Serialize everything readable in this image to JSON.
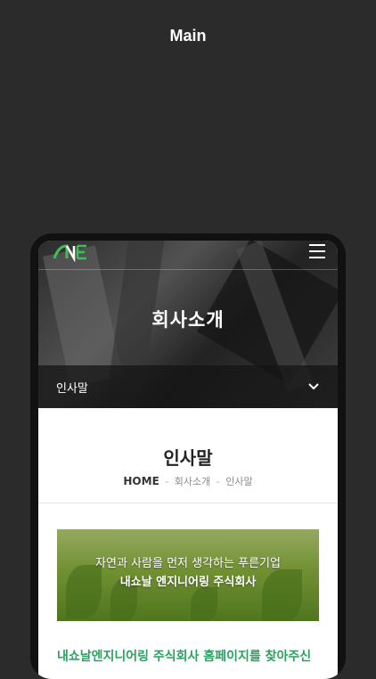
{
  "page": {
    "title": "Main"
  },
  "header": {
    "logo_text": "NE",
    "menu_icon": "hamburger-menu-icon",
    "hero_title": "회사소개"
  },
  "subnav": {
    "label": "인사말",
    "icon": "chevron-down-icon"
  },
  "content": {
    "title": "인사말",
    "breadcrumb": {
      "home": "HOME",
      "level1": "회사소개",
      "level2": "인사말",
      "separator": "-"
    },
    "banner": {
      "line1": "자연과 사람을 먼저 생각하는 푸른기업",
      "line2": "내쇼날 엔지니어링 주식회사"
    },
    "intro_text": "내쇼날엔지니어링 주식회사 홈페이지를 찾아주신"
  },
  "colors": {
    "accent_green": "#2aa160",
    "background": "#2b2b2b"
  }
}
